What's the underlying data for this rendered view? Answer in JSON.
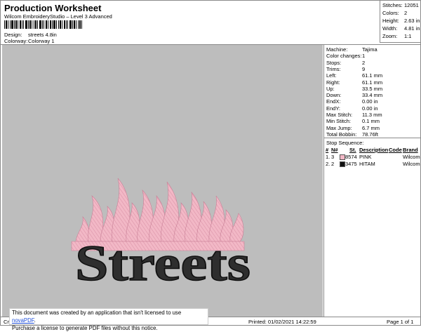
{
  "header": {
    "title": "Production Worksheet",
    "subtitle": "Wilcom EmbroideryStudio – Level 3 Advanced",
    "design_label": "Design:",
    "design_value": "streets 4.8in",
    "colorway_label": "Colorway:",
    "colorway_value": "Colorway 1"
  },
  "stats": {
    "stitches_label": "Stitches:",
    "stitches_value": "12051",
    "colors_label": "Colors:",
    "colors_value": "2",
    "height_label": "Height:",
    "height_value": "2.63 in",
    "width_label": "Width:",
    "width_value": "4.81 in",
    "zoom_label": "Zoom:",
    "zoom_value": "1:1"
  },
  "machine": [
    {
      "label": "Machine:",
      "value": "Tajima"
    },
    {
      "label": "Color changes:",
      "value": "1"
    },
    {
      "label": "Stops:",
      "value": "2"
    },
    {
      "label": "Trims:",
      "value": "9"
    },
    {
      "label": "Left:",
      "value": "61.1 mm"
    },
    {
      "label": "Right:",
      "value": "61.1 mm"
    },
    {
      "label": "Up:",
      "value": "33.5 mm"
    },
    {
      "label": "Down:",
      "value": "33.4 mm"
    },
    {
      "label": "EndX:",
      "value": "0.00 in"
    },
    {
      "label": "EndY:",
      "value": "0.00 in"
    },
    {
      "label": "Max Stitch:",
      "value": "11.3 mm"
    },
    {
      "label": "Min Stitch:",
      "value": "0.1 mm"
    },
    {
      "label": "Max Jump:",
      "value": "6.7 mm"
    },
    {
      "label": "Total Bobbin:",
      "value": "78.76ft"
    }
  ],
  "stop_sequence": {
    "heading": "Stop Sequence:",
    "columns": [
      "#",
      "N#",
      "St.",
      "Description",
      "Code",
      "Brand"
    ],
    "rows": [
      {
        "num": "1.",
        "n": "3",
        "st": "8574",
        "desc": "PINK",
        "code": "",
        "brand": "Wilcom",
        "color": "#f2b8c6"
      },
      {
        "num": "2.",
        "n": "2",
        "st": "3475",
        "desc": "HITAM",
        "code": "",
        "brand": "Wilcom",
        "color": "#111111"
      }
    ]
  },
  "design": {
    "text": "Streets",
    "text_color": "#2e2e2e",
    "flame_color": "#f2b8c6",
    "background": "#bdbdbd"
  },
  "footer": {
    "left": "Cr",
    "printed": "Printed: 01/02/2021 14:22:59",
    "page": "Page 1 of 1"
  },
  "notice": {
    "line1_prefix": "This document was created by an application that isn't licensed to use ",
    "link": "novaPDF",
    "line1_suffix": ".",
    "line2": "Purchase a license to generate PDF files without this notice."
  }
}
